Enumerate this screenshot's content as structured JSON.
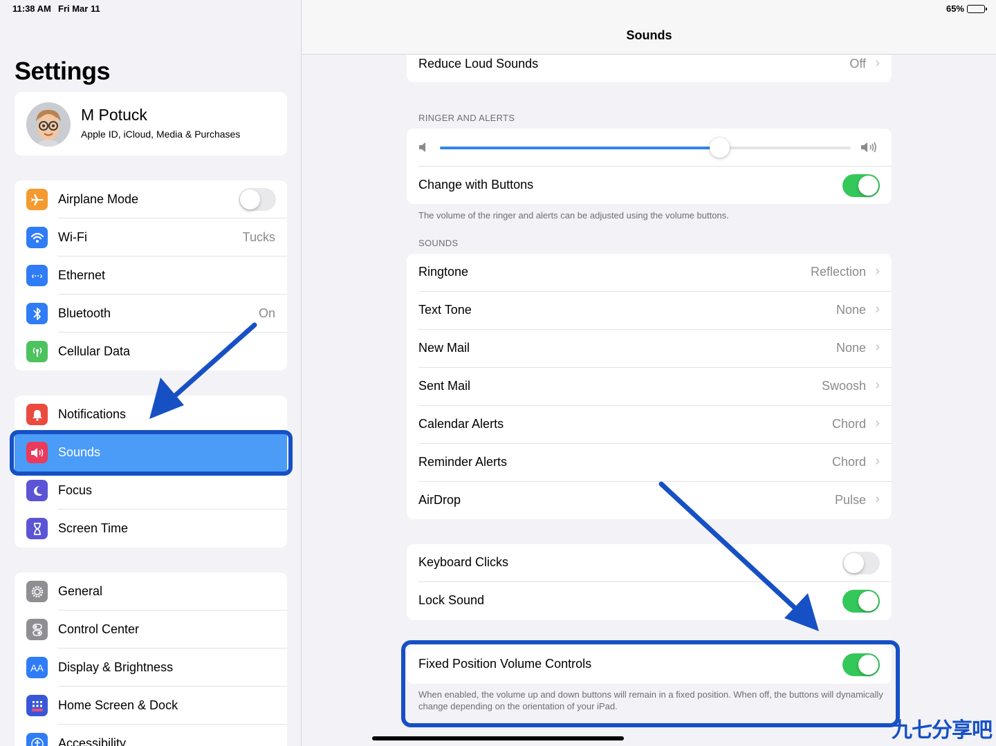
{
  "status": {
    "time": "11:38 AM",
    "date": "Fri Mar 11",
    "battery": "65%",
    "battery_level": 0.65
  },
  "sidebar": {
    "title": "Settings",
    "profile": {
      "name": "M Potuck",
      "subtitle": "Apple ID, iCloud, Media & Purchases"
    },
    "group1": [
      {
        "label": "Airplane Mode",
        "icon": "airplane-icon",
        "color": "#f49a2e",
        "toggle": false
      },
      {
        "label": "Wi-Fi",
        "icon": "wifi-icon",
        "color": "#2f7cf6",
        "value": "Tucks"
      },
      {
        "label": "Ethernet",
        "icon": "ethernet-icon",
        "color": "#2f7cf6"
      },
      {
        "label": "Bluetooth",
        "icon": "bluetooth-icon",
        "color": "#2f7cf6",
        "value": "On"
      },
      {
        "label": "Cellular Data",
        "icon": "cellular-icon",
        "color": "#4cc35f"
      }
    ],
    "group2": [
      {
        "label": "Notifications",
        "icon": "bell-icon",
        "color": "#eb4a3f"
      },
      {
        "label": "Sounds",
        "icon": "speaker-icon",
        "color": "#eb3a5a",
        "selected": true
      },
      {
        "label": "Focus",
        "icon": "moon-icon",
        "color": "#5b55d6"
      },
      {
        "label": "Screen Time",
        "icon": "hourglass-icon",
        "color": "#5b55d6"
      }
    ],
    "group3": [
      {
        "label": "General",
        "icon": "gear-icon",
        "color": "#8e8e93"
      },
      {
        "label": "Control Center",
        "icon": "switches-icon",
        "color": "#8e8e93"
      },
      {
        "label": "Display & Brightness",
        "icon": "text-size-icon",
        "color": "#2f7cf6",
        "glyph": "AA"
      },
      {
        "label": "Home Screen & Dock",
        "icon": "grid-icon",
        "color": "#3857d8"
      },
      {
        "label": "Accessibility",
        "icon": "accessibility-icon",
        "color": "#2f7cf6"
      }
    ]
  },
  "detail": {
    "title": "Sounds",
    "reduce_loud": {
      "label": "Reduce Loud Sounds",
      "value": "Off"
    },
    "ringer_header": "RINGER AND ALERTS",
    "ringer_level": 0.68,
    "change_buttons": {
      "label": "Change with Buttons",
      "on": true
    },
    "ringer_footer": "The volume of the ringer and alerts can be adjusted using the volume buttons.",
    "sounds_header": "SOUNDS",
    "sounds": [
      {
        "label": "Ringtone",
        "value": "Reflection"
      },
      {
        "label": "Text Tone",
        "value": "None"
      },
      {
        "label": "New Mail",
        "value": "None"
      },
      {
        "label": "Sent Mail",
        "value": "Swoosh"
      },
      {
        "label": "Calendar Alerts",
        "value": "Chord"
      },
      {
        "label": "Reminder Alerts",
        "value": "Chord"
      },
      {
        "label": "AirDrop",
        "value": "Pulse"
      }
    ],
    "keyboard_clicks": {
      "label": "Keyboard Clicks",
      "on": false
    },
    "lock_sound": {
      "label": "Lock Sound",
      "on": true
    },
    "fixed_volume": {
      "label": "Fixed Position Volume Controls",
      "on": true
    },
    "fixed_footer": "When enabled, the volume up and down buttons will remain in a fixed position. When off, the buttons will dynamically change depending on the orientation of your iPad."
  },
  "watermark": "九七分享吧",
  "colors": {
    "accent": "#2e85e8",
    "toggle_on": "#34c759",
    "annotation": "#1650c4",
    "selected_row": "#4a9cf7"
  }
}
